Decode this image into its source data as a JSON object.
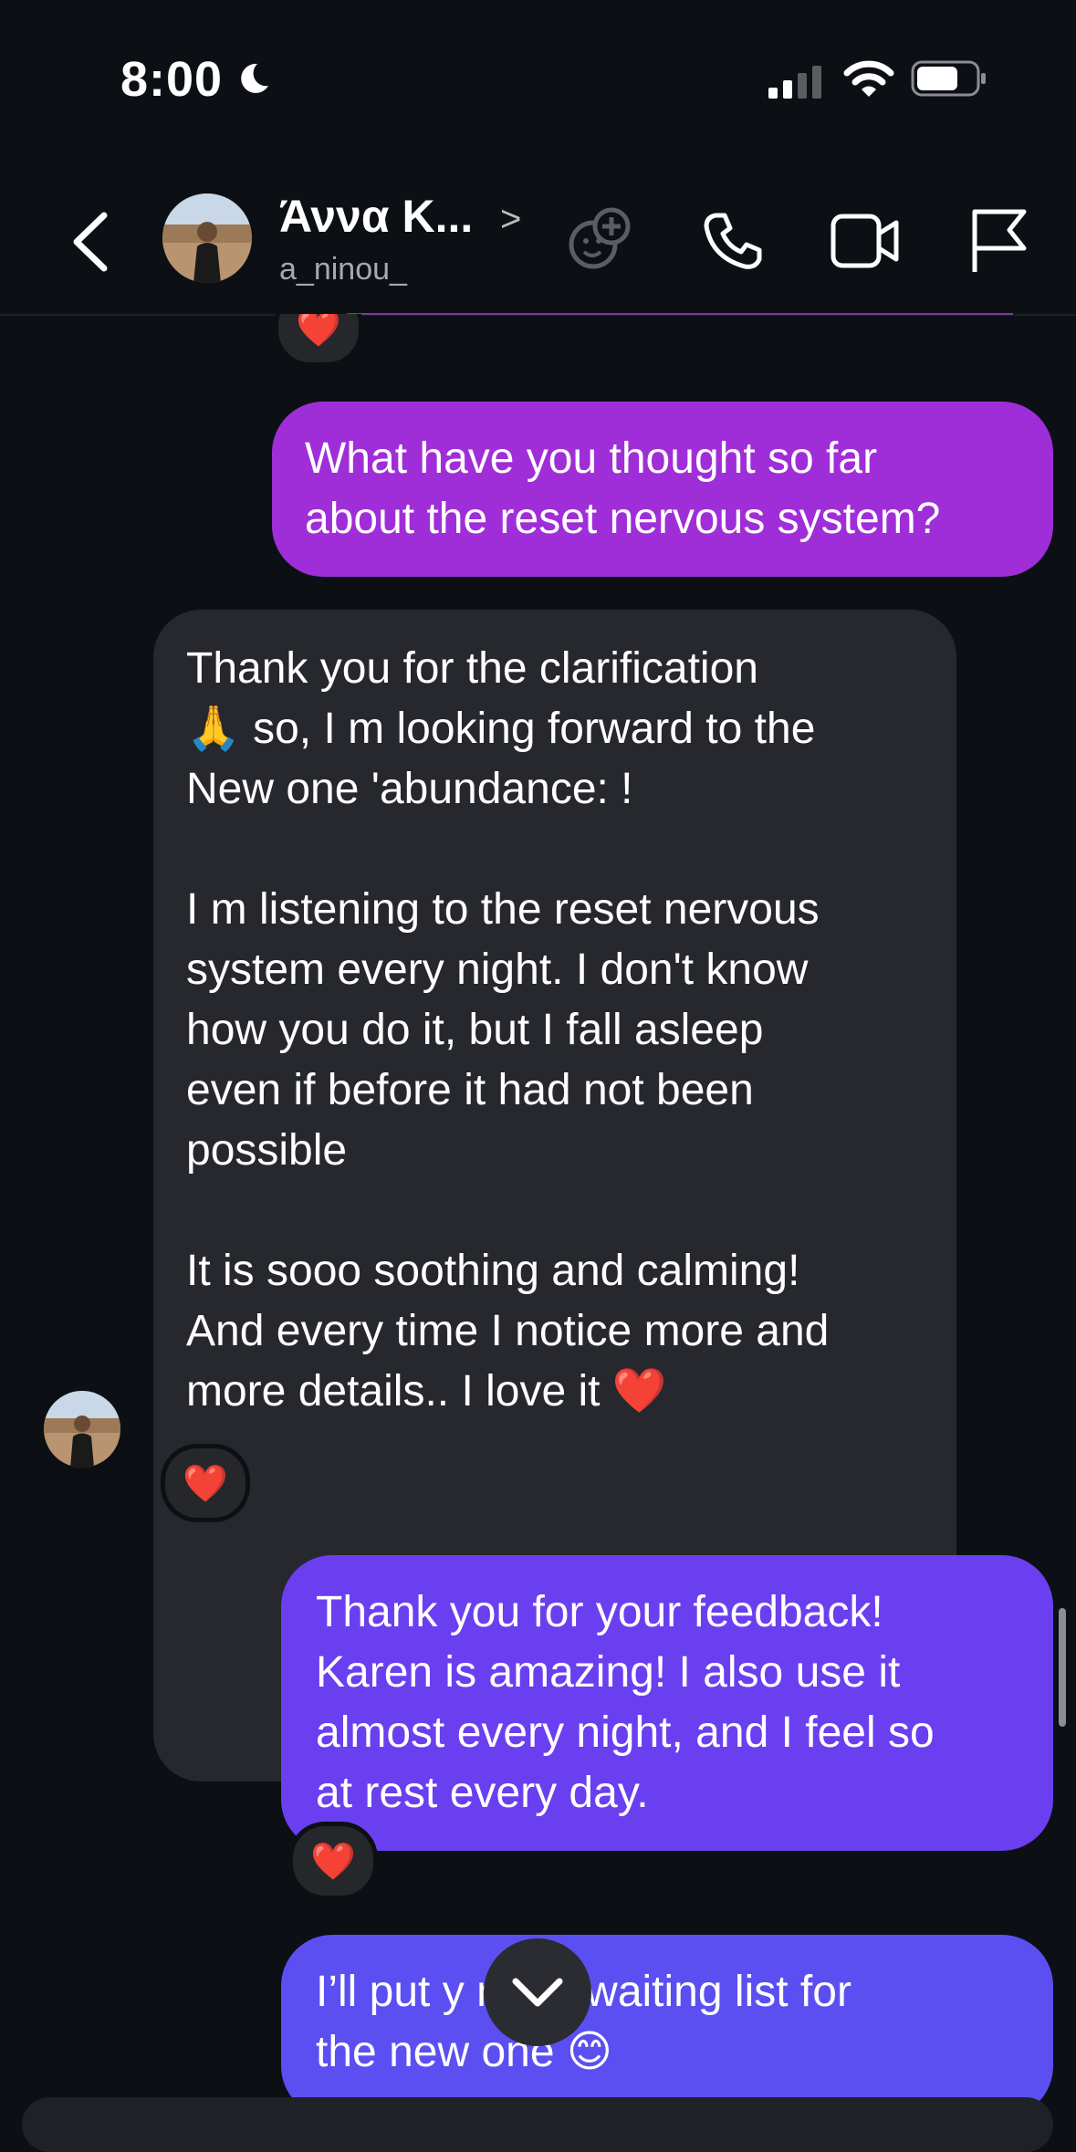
{
  "status": {
    "time": "8:00"
  },
  "header": {
    "name": "Άννα Κ...",
    "chevron": ">",
    "username": "a_ninou_"
  },
  "messages": [
    {
      "id": "out1",
      "text": "What have you thought so far\nabout the reset nervous system?"
    },
    {
      "id": "in1",
      "text": "Thank you for the clarification\n🙏 so, I m looking forward to the\nNew one 'abundance: !\n\nI m listening to the reset nervous\nsystem every night. I don't know\nhow you do it, but I fall asleep\neven if before it had not been\npossible\n\nIt is sooo soothing and calming!\nAnd every time I notice more and\nmore details.. I love it ❤️"
    },
    {
      "id": "out2",
      "text": "Thank you for your feedback!\nKaren is amazing! I also use it\nalmost every night, and I feel so\nat rest every day."
    },
    {
      "id": "out3",
      "text": "I’ll put y      n the waiting list for\nthe new one 😊"
    }
  ],
  "reactions": {
    "heart": "❤️"
  },
  "colors": {
    "background": "#0c0f14",
    "incoming": "#26282d",
    "outgoing_pink": "#a02ed8",
    "outgoing_purple": "#6a3ff0"
  }
}
